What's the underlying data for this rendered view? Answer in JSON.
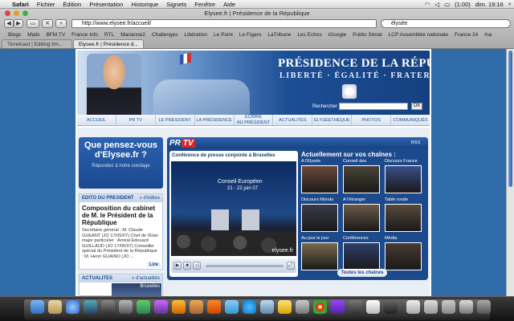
{
  "menubar": {
    "apple": "",
    "app": "Safari",
    "items": [
      "Fichier",
      "Édition",
      "Présentation",
      "Historique",
      "Signets",
      "Fenêtre",
      "Aide"
    ],
    "battery": "(1:00)",
    "clock": "dim. 19:16"
  },
  "browser": {
    "window_title": "Elysee.fr | Présidence de la République",
    "url": "http://www.elysee.fr/accueil/",
    "search_value": "élysée",
    "bookmarks": [
      "Blogs",
      "Mails",
      "BFM TV",
      "France Info",
      "RTL",
      "Marianne2",
      "Challenges",
      "Libération",
      "Le Point",
      "Le Figaro",
      "LaTribune",
      "Les Echos",
      "iGoogle",
      "Public Sénat",
      "LCP Assemblée nationale",
      "France 24",
      "Ina"
    ],
    "tabs": [
      {
        "label": "Timetoast | Editing tim...",
        "active": false
      },
      {
        "label": "Elysee.fr | Présidence d...",
        "active": true
      }
    ]
  },
  "site": {
    "title": "PRÉSIDENCE DE LA RÉPUBLIQUE",
    "motto": "LIBERTÉ · ÉGALITÉ · FRATERNITÉ",
    "search_label": "Rechercher",
    "search_button": "OK",
    "nav": [
      "ACCUEIL",
      "PR TV",
      "LE PRÉSIDENT",
      "LA PRÉSIDENCE",
      "ÉCRIRE\nAU PRÉSIDENT",
      "ACTUALITÉS",
      "ÉLYSÉETHÈQUE",
      "PHOTOS",
      "COMMUNIQUÉS"
    ],
    "ad": {
      "line1": "Que pensez-vous",
      "line2": "d'Elysee.fr ?",
      "line3": "Répondez à notre sondage"
    },
    "edito": {
      "header": "EDITO DU PRESIDENT",
      "more": "» d'éditos",
      "headline": "Composition du cabinet de M. le Président de la République",
      "body": "Secrétaire général : M. Claude GUEANT (JO 17/05/07) Chef de l'Etat-major particulier : Amiral Edouard GUILLAUD (JO 17/05/07) Conseiller spécial du Président de la République : M. Henri GUAINO (JO ...",
      "read": "Lire"
    },
    "actus": {
      "header": "ACTUALITES",
      "more": "» d'actualités",
      "thumb_text": "Bruxelles"
    },
    "prtv": {
      "logo_pr": "PR",
      "logo_tv": "TV",
      "rss": "RSS",
      "video_title": "Conférence de presse conjointe à Bruxelles",
      "caption1": "Conseil Européen",
      "caption2": "21 · 22 juin 07",
      "watermark": "elysee.fr",
      "chains_title": "Actuellement sur vos chaînes :",
      "chains": [
        {
          "label": "A l'Elysée",
          "color": "#6b4a3a"
        },
        {
          "label": "Conseil des",
          "color": "#4a4438"
        },
        {
          "label": "Discours France",
          "color": "#3b4f8a"
        },
        {
          "label": "Discours Monde",
          "color": "#3a3a4c"
        },
        {
          "label": "A l'étranger",
          "color": "#6a5a48"
        },
        {
          "label": "Table ronde",
          "color": "#5a4a3c"
        },
        {
          "label": "Au jour le jour",
          "color": "#7a6a4a"
        },
        {
          "label": "Conférences",
          "color": "#2f3f6a"
        },
        {
          "label": "Média",
          "color": "#4a3a32"
        }
      ],
      "all_channels": "Toutes les chaînes"
    }
  }
}
